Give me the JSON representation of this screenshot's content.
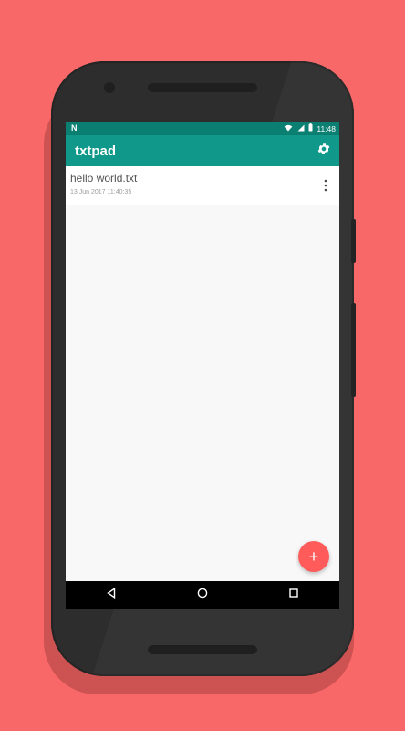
{
  "colors": {
    "background": "#f96868",
    "phone_body": "#2d2d2d",
    "status_bar": "#0b7f71",
    "app_bar": "#10998a",
    "fab": "#ff5b5b"
  },
  "status_bar": {
    "notification_icon": "n-icon",
    "icons": [
      "wifi-icon",
      "signal-icon",
      "battery-icon"
    ],
    "time": "11:48"
  },
  "app_bar": {
    "title": "txtpad",
    "settings_icon": "gear-icon"
  },
  "files": [
    {
      "name": "hello world.txt",
      "date": "13 Jun 2017 11:40:35",
      "menu_icon": "more-vertical-icon"
    }
  ],
  "fab": {
    "label": "+",
    "icon": "plus-icon"
  },
  "nav_bar": {
    "items": [
      "back-icon",
      "home-icon",
      "recents-icon"
    ]
  }
}
